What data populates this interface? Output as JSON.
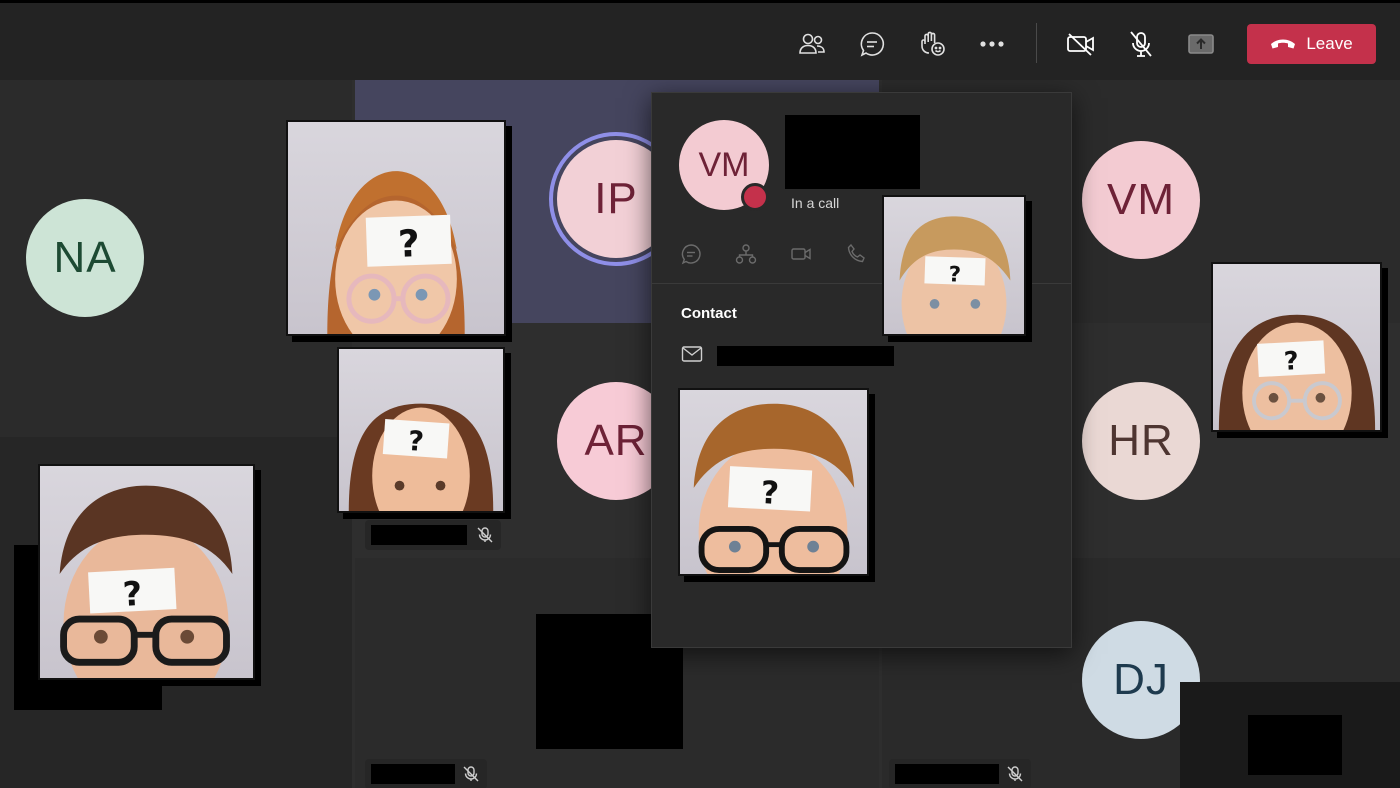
{
  "toolbar": {
    "leave_label": "Leave",
    "leave_color": "#c4314b",
    "icons": [
      "people-icon",
      "chat-icon",
      "react-icon",
      "more-icon",
      "camera-off-icon",
      "mic-off-icon",
      "share-icon"
    ]
  },
  "participants": [
    {
      "initials": "NA",
      "bg": "#cde4d6",
      "fg": "#1d4a33"
    },
    {
      "initials": "IP",
      "bg": "#f2d0d6",
      "fg": "#6e2237"
    },
    {
      "initials": "AR",
      "bg": "#f7cbd6",
      "fg": "#6e2237"
    },
    {
      "initials": "VM",
      "bg": "#f3cbd2",
      "fg": "#6e2237"
    },
    {
      "initials": "HR",
      "bg": "#ead8d4",
      "fg": "#4e3531"
    },
    {
      "initials": "DJ",
      "bg": "#cfdbe4",
      "fg": "#1e3a4e"
    }
  ],
  "contact_card": {
    "initials": "VM",
    "status": "In a call",
    "section_label": "Contact",
    "presence_color": "#c4314b"
  },
  "stickers": {
    "mark": "?"
  }
}
